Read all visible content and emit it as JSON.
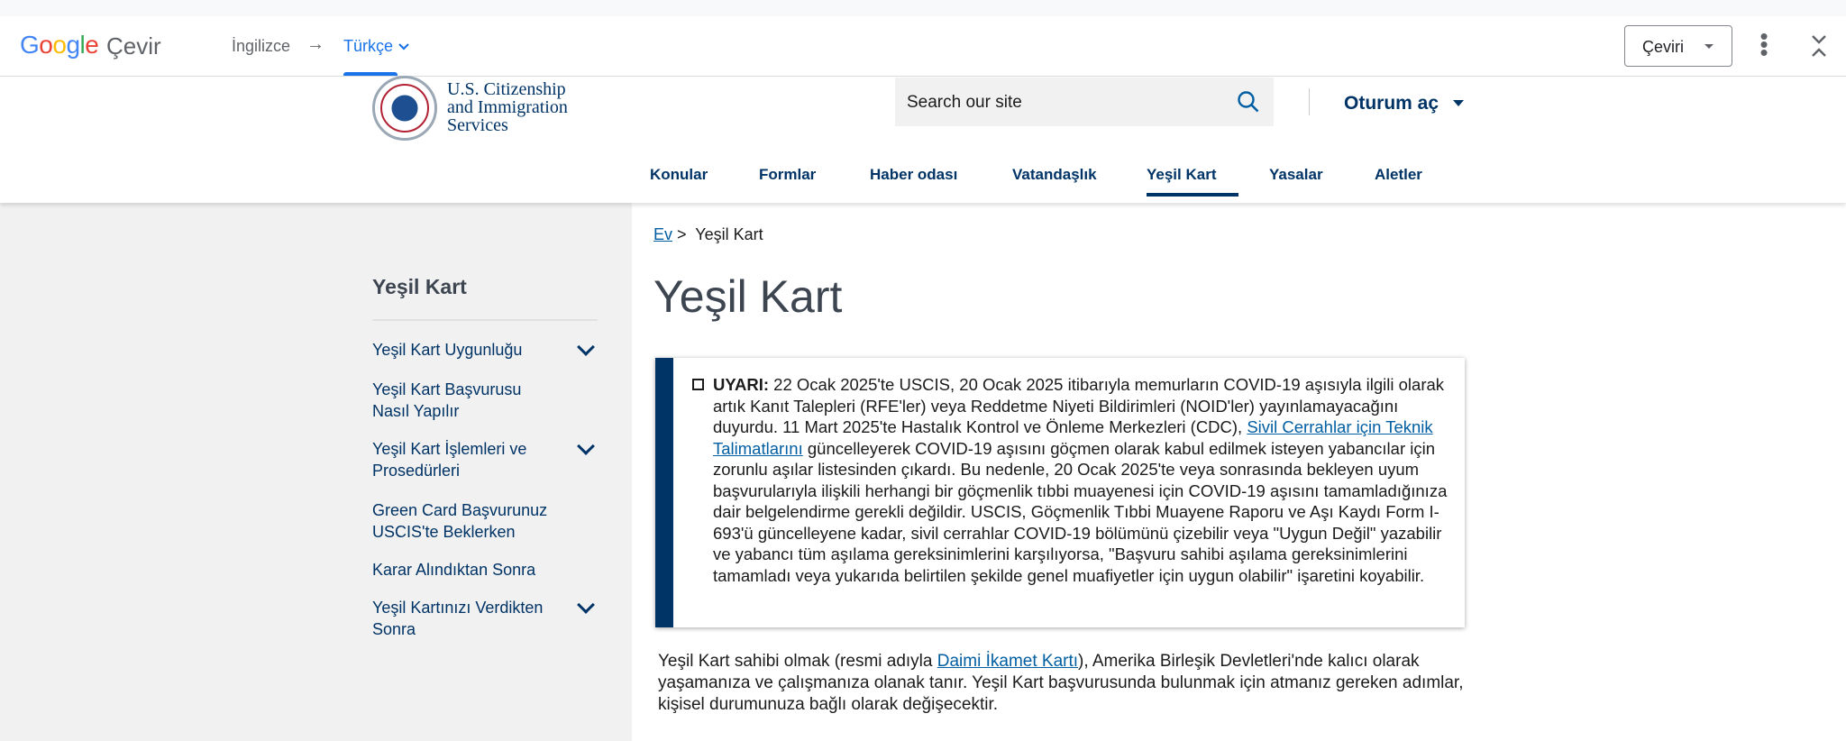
{
  "translate_bar": {
    "logo": {
      "G": "G",
      "o1": "o",
      "o2": "o",
      "g": "g",
      "l": "l",
      "e": "e"
    },
    "title": "Çevir",
    "source_lang": "İngilizce",
    "arrow": "→",
    "target_lang": "Türkçe",
    "translate_button": "Çeviri",
    "more_icon": "⋮",
    "collapse_icon": "collapse-icon"
  },
  "site_header": {
    "agency_line1": "U.S. Citizenship",
    "agency_line2": "and Immigration",
    "agency_line3": "Services",
    "search_placeholder": "Search our site",
    "login": "Oturum aç",
    "nav": [
      "Konular",
      "Formlar",
      "Haber odası",
      "Vatandaşlık",
      "Yeşil Kart",
      "Yasalar",
      "Aletler"
    ],
    "active_nav": "Yeşil Kart"
  },
  "sidebar": {
    "title": "Yeşil Kart",
    "items": [
      {
        "label": "Yeşil Kart Uygunluğu",
        "expandable": true
      },
      {
        "label": "Yeşil Kart Başvurusu Nasıl Yapılır",
        "expandable": false
      },
      {
        "label": "Yeşil Kart İşlemleri ve Prosedürleri",
        "expandable": true
      },
      {
        "label": "Green Card Başvurunuz USCIS'te Beklerken",
        "expandable": false
      },
      {
        "label": "Karar Alındıktan Sonra",
        "expandable": false
      },
      {
        "label": "Yeşil Kartınızı Verdikten Sonra",
        "expandable": true
      }
    ]
  },
  "breadcrumb": {
    "home": "Ev",
    "sep": ">",
    "current": "Yeşil Kart"
  },
  "page_title": "Yeşil Kart",
  "alert": {
    "label": "UYARI:",
    "text_before": " 22 Ocak 2025'te USCIS, 20 Ocak 2025 itibarıyla memurların COVID-19 aşısıyla ilgili olarak artık Kanıt Talepleri (RFE'ler) veya Reddetme Niyeti Bildirimleri (NOID'ler) yayınlamayacağını duyurdu. 11 Mart 2025'te Hastalık Kontrol ve Önleme Merkezleri (CDC), ",
    "link": "Sivil Cerrahlar için Teknik Talimatlarını",
    "text_after": " güncelleyerek COVID-19 aşısını göçmen olarak kabul edilmek isteyen yabancılar için zorunlu aşılar listesinden çıkardı. Bu nedenle, 20 Ocak 2025'te veya sonrasında bekleyen uyum başvurularıyla ilişkili herhangi bir göçmenlik tıbbi muayenesi için COVID-19 aşısını tamamladığınıza dair belgelendirme gerekli değildir. USCIS, Göçmenlik Tıbbi Muayene Raporu ve Aşı Kaydı Form I-693'ü güncelleyene kadar, sivil cerrahlar COVID-19 bölümünü çizebilir veya \"Uygun Değil\" yazabilir ve yabancı tüm aşılama gereksinimlerini karşılıyorsa, \"Başvuru sahibi aşılama gereksinimlerini tamamladı veya yukarıda belirtilen şekilde genel muafiyetler için uygun olabilir\" işaretini koyabilir."
  },
  "intro": {
    "text_before": "Yeşil Kart sahibi olmak (resmi adıyla ",
    "link": "Daimi İkamet Kartı",
    "text_after": "), Amerika Birleşik Devletleri'nde kalıcı olarak yaşamanıza ve çalışmanıza olanak tanır. Yeşil Kart başvurusunda bulunmak için atmanız gereken adımlar, kişisel durumunuza bağlı olarak değişecektir."
  },
  "colors": {
    "navy": "#003366",
    "link": "#005ea2",
    "google_blue": "#1a73e8",
    "sidebar_bg": "#f1f1f1"
  }
}
